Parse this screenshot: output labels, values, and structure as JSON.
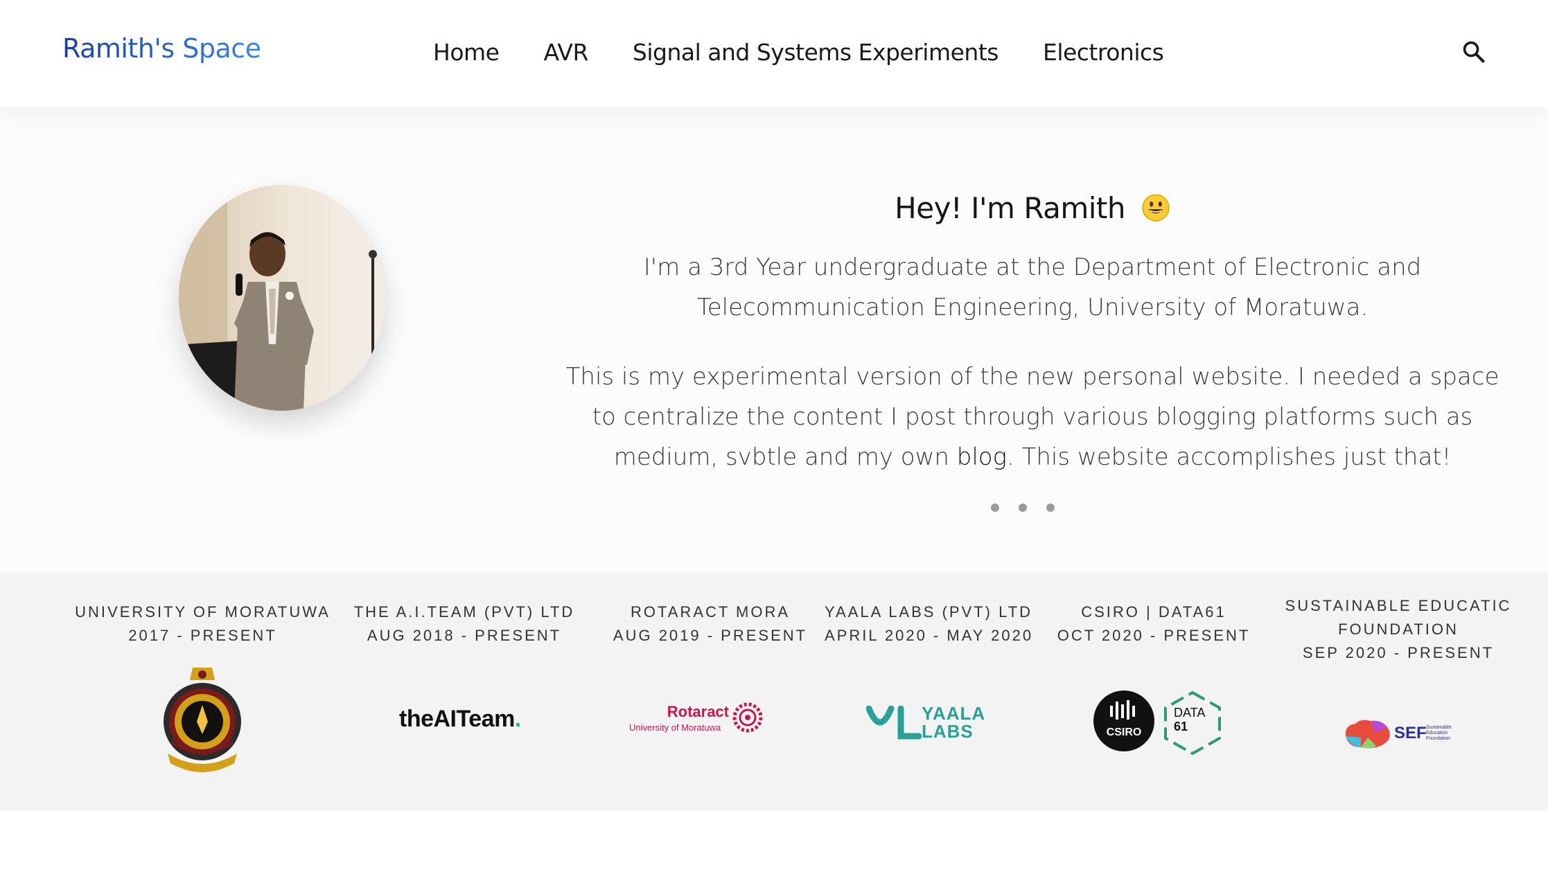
{
  "header": {
    "brand": "Ramith's Space",
    "nav": [
      "Home",
      "AVR",
      "Signal and Systems Experiments",
      "Electronics"
    ],
    "search_icon": "search-icon"
  },
  "hero": {
    "greeting": "Hey! I'm Ramith",
    "paragraph1": "I'm a 3rd Year undergraduate at the Department of Electronic and Telecommunication Engineering, University of Moratuwa.",
    "paragraph2_before": "This is my experimental version of the new personal website. I needed a space to centralize the content I post through various blogging platforms such as medium, svbtle and my own ",
    "paragraph2_link": "blog",
    "paragraph2_after": ". This website accomplishes just that!"
  },
  "timeline": [
    {
      "name": "UNIVERSITY OF MORATUWA",
      "period": "2017 - PRESENT"
    },
    {
      "name": "THE A.I.TEAM (PVT) LTD",
      "period": "AUG 2018 - PRESENT",
      "logo_text": "theAITeam"
    },
    {
      "name": "ROTARACT MORA",
      "period": "AUG 2019 - PRESENT",
      "logo_text": "Rotaract",
      "logo_subtext": "University of Moratuwa"
    },
    {
      "name": "YAALA LABS (PVT) LTD",
      "period": "APRIL 2020 - MAY 2020",
      "logo_text": "YAALA",
      "logo_text2": "LABS"
    },
    {
      "name": "CSIRO | DATA61",
      "period": "OCT 2020 - PRESENT",
      "logo_text": "CSIRO",
      "logo_text2": "DATA",
      "logo_text3": "61"
    },
    {
      "name": "SUSTAINABLE EDUCATIC",
      "name2": "FOUNDATION",
      "period": "SEP 2020 - PRESENT",
      "logo_text": "SEF",
      "logo_subtext": "Sustainable Education Foundation"
    }
  ],
  "colors": {
    "brand_start": "#1a3ea0",
    "brand_end": "#3d86dc",
    "strip_bg": "#f3f3f3",
    "rotaract": "#c8174f",
    "yaala": "#2aa198",
    "data61": "#2c9b6f"
  }
}
